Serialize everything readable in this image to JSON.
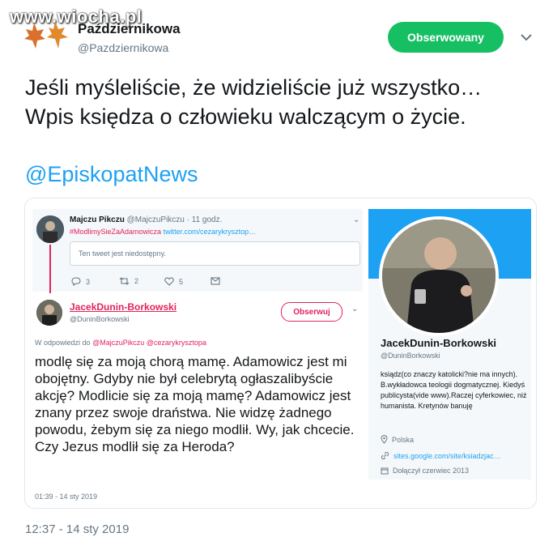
{
  "watermark": "www.wiocha.pl",
  "author": {
    "name": "Październikowa",
    "handle": "@Pazdziernikowa"
  },
  "follow_button": "Obserwowany",
  "tweet_text_line1": "Jeśli myśleliście, że widzieliście już wszystko…",
  "tweet_text_line2": "Wpis księdza o człowieku walczącym o życie.",
  "mention": "@EpiskopatNews",
  "timestamp": "12:37 - 14 sty 2019",
  "embedded": {
    "quoted": {
      "name": "Majczu Pikczu",
      "handle_time": "@MajczuPikczu · 11 godz.",
      "hashtag": "#ModlimySieZaAdamowicza",
      "link": "twitter.com/cezarykrysztop…",
      "unavailable": "Ten tweet jest niedostępny.",
      "replies": "3",
      "retweets": "2",
      "likes": "5"
    },
    "reply": {
      "name": "JacekDunin-Borkowski",
      "handle": "@DuninBorkowski",
      "follow_label": "Obserwuj",
      "reply_prefix": "W odpowiedzi do",
      "reply_users": "@MajczuPikczu @cezarykrysztopa",
      "text": "modlę się za moją chorą mamę. Adamowicz jest mi obojętny. Gdyby nie był celebrytą ogłaszalibyście akcję? Modlicie się za moją mamę? Adamowicz jest znany przez swoje draństwa. Nie widzę żadnego powodu, żebym się za niego modlił. Wy, jak chcecie. Czy Jezus modlił się za Heroda?",
      "time": "01:39 - 14 sty 2019"
    },
    "profile": {
      "name": "JacekDunin-Borkowski",
      "handle": "@DuninBorkowski",
      "bio": "ksiądz(co znaczy katolicki?nie ma innych). B.wykładowca teologii dogmatycznej. Kiedyś publicysta(vide www).Raczej cyferkowiec, niż humanista. Kretynów banuję",
      "location": "Polska",
      "website": "sites.google.com/site/ksiadzjac…",
      "joined": "Dołączył czerwiec 2013"
    }
  },
  "colors": {
    "accent": "#1da1f2",
    "follow_green": "#17bf63",
    "pink": "#e0245e"
  }
}
